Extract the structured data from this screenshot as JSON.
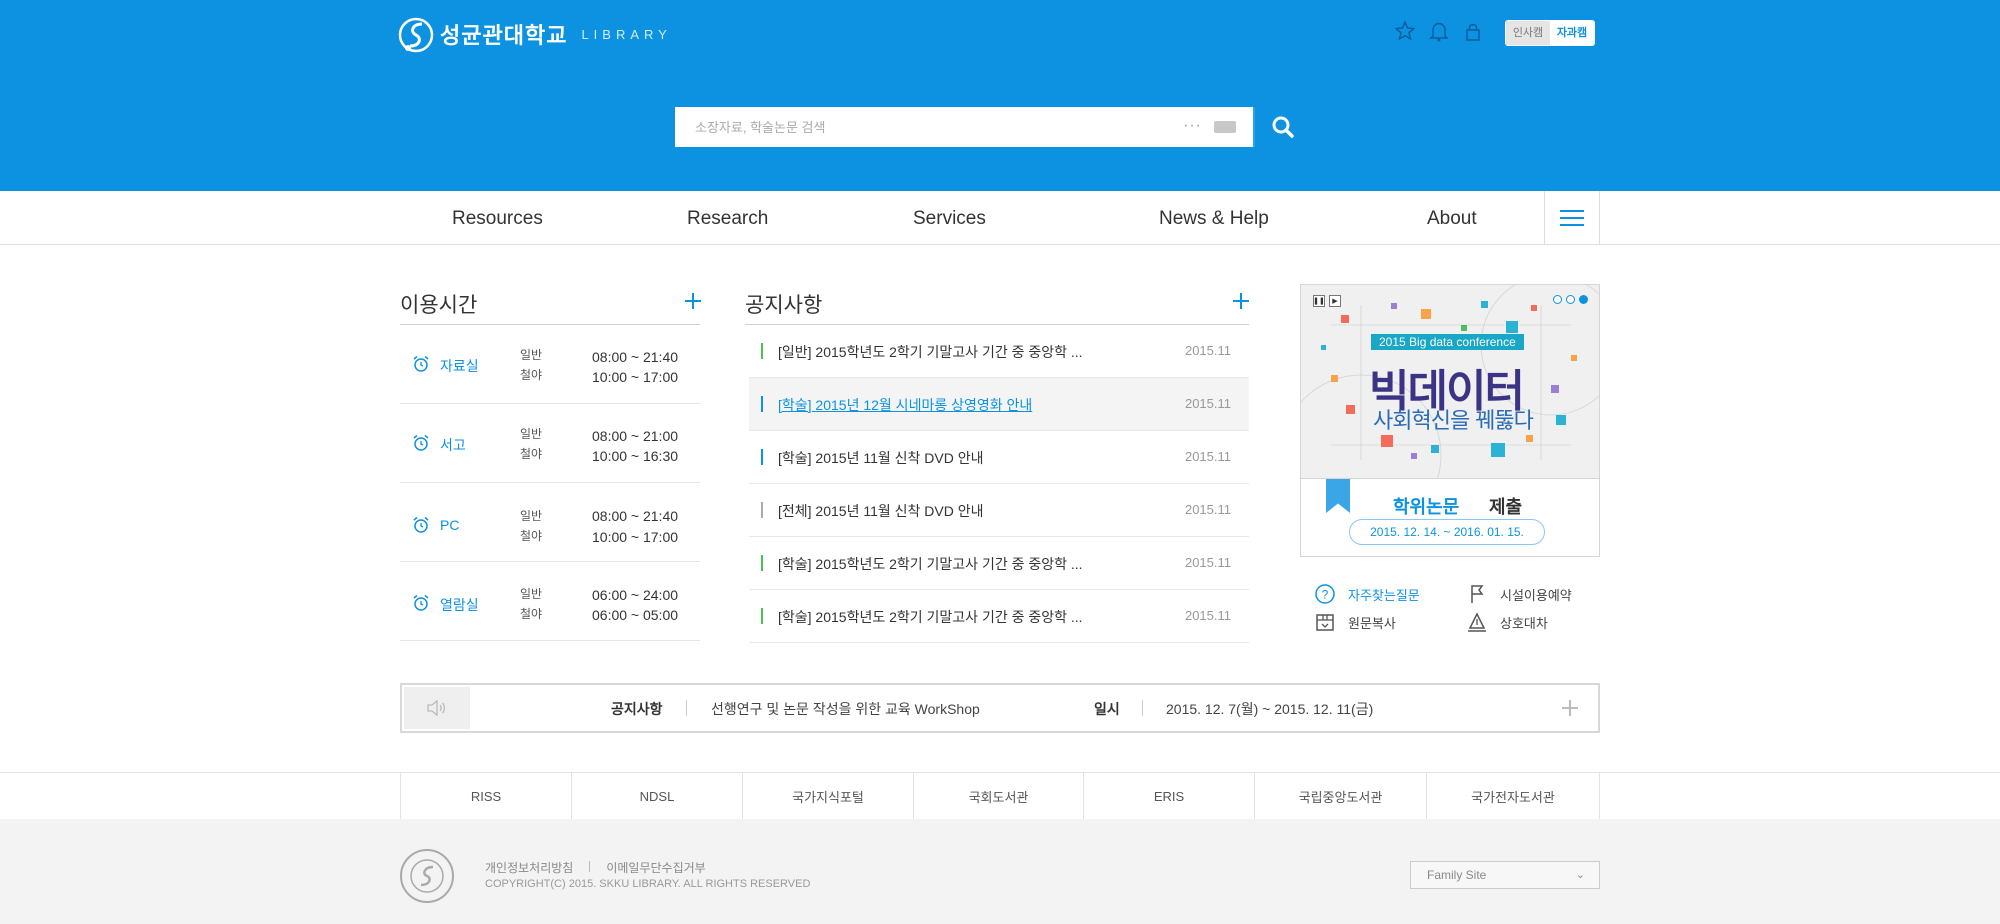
{
  "header": {
    "logo_name": "성균관대학교",
    "logo_sub": "LIBRARY",
    "campus": [
      "인사캠",
      "자과캠"
    ],
    "search_placeholder": "소장자료, 학술논문 검색",
    "search_more": "···"
  },
  "nav": [
    "Resources",
    "Research",
    "Services",
    "News & Help",
    "About"
  ],
  "hours": {
    "title": "이용시간",
    "rows": [
      {
        "name": "자료실",
        "labels": [
          "일반",
          "철야"
        ],
        "times": [
          "08:00 ~ 21:40",
          "10:00 ~ 17:00"
        ]
      },
      {
        "name": "서고",
        "labels": [
          "일반",
          "철야"
        ],
        "times": [
          "08:00 ~ 21:00",
          "10:00 ~ 16:30"
        ]
      },
      {
        "name": "PC",
        "labels": [
          "일반",
          "철야"
        ],
        "times": [
          "08:00 ~ 21:40",
          "10:00 ~ 17:00"
        ]
      },
      {
        "name": "열람실",
        "labels": [
          "일반",
          "철야"
        ],
        "times": [
          "06:00 ~ 24:00",
          "06:00 ~ 05:00"
        ]
      }
    ]
  },
  "notices": {
    "title": "공지사항",
    "items": [
      {
        "text": "[일반] 2015학년도 2학기 기말고사 기간 중 중앙학 ...",
        "date": "2015.11",
        "color": "#4cbf5b"
      },
      {
        "text": "[학술] 2015년 12월 시네마롱 상영영화 안내",
        "date": "2015.11",
        "color": "#0d92e2"
      },
      {
        "text": "[학술] 2015년 11월 신착 DVD 안내",
        "date": "2015.11",
        "color": "#0d92e2"
      },
      {
        "text": "[전체] 2015년 11월 신착 DVD 안내",
        "date": "2015.11",
        "color": "#aaaaaa"
      },
      {
        "text": "[학술] 2015학년도 2학기 기말고사 기간 중 중앙학 ...",
        "date": "2015.11",
        "color": "#4cbf5b"
      },
      {
        "text": "[학술] 2015학년도 2학기 기말고사 기간 중 중앙학 ...",
        "date": "2015.11",
        "color": "#4cbf5b"
      }
    ]
  },
  "banner": {
    "conf": "2015 Big data conference",
    "big": "빅데이터",
    "sub": "사회혁신을 꿰뚫다",
    "t1": "학위논문",
    "t2": "제출",
    "date": "2015. 12. 14. ~ 2016. 01. 15."
  },
  "quick_links": [
    "자주찾는질문",
    "시설이용예약",
    "원문복사",
    "상호대차"
  ],
  "notice_bar": {
    "label": "공지사항",
    "text": "선행연구 및 논문 작성을 위한 교육 WorkShop",
    "date_label": "일시",
    "date": "2015. 12. 7(월) ~ 2015. 12. 11(금)"
  },
  "related": [
    "RISS",
    "NDSL",
    "국가지식포털",
    "국회도서관",
    "ERIS",
    "국립중앙도서관",
    "국가전자도서관"
  ],
  "footer": {
    "link1": "개인정보처리방침",
    "link2": "이메일무단수집거부",
    "copyright": "COPYRIGHT(C) 2015.  SKKU LIBRARY.  ALL RIGHTS RESERVED",
    "family": "Family Site"
  },
  "colors": {
    "primary": "#0d92e2",
    "green": "#4cbf5b"
  }
}
